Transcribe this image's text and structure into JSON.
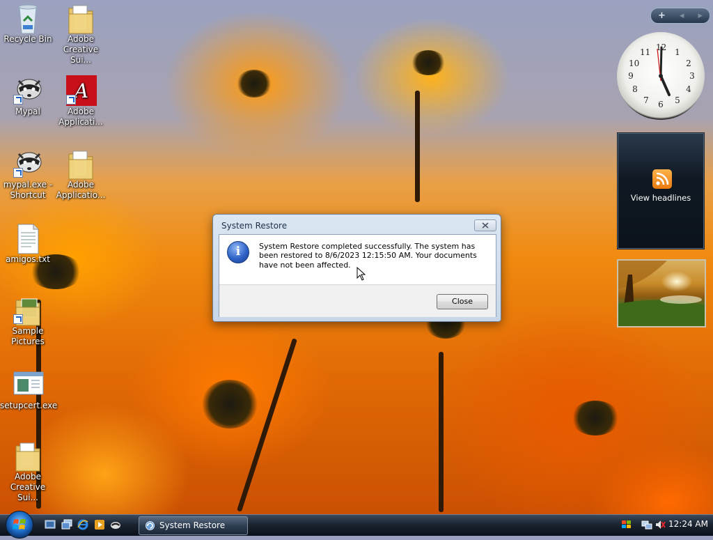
{
  "desktop": {
    "icons": [
      {
        "label": "Recycle Bin",
        "icon": "recycle-bin-icon"
      },
      {
        "label": "Adobe Creative Sui...",
        "icon": "folder-icon"
      },
      {
        "label": "Mypal",
        "icon": "raccoon-app-icon"
      },
      {
        "label": "Adobe Applicati...",
        "icon": "adobe-icon"
      },
      {
        "label": "mypal.exe - Shortcut",
        "icon": "raccoon-app-icon"
      },
      {
        "label": "Adobe Applicatio...",
        "icon": "folder-icon"
      },
      {
        "label": "amigos.txt",
        "icon": "text-file-icon"
      },
      {
        "label": "Sample Pictures",
        "icon": "folder-icon"
      },
      {
        "label": "setupcert.exe",
        "icon": "exe-window-icon"
      },
      {
        "label": "Adobe Creative Sui...",
        "icon": "folder-icon"
      }
    ]
  },
  "sidebar": {
    "controls": {
      "add": "+",
      "prev": "◂",
      "next": "▸"
    },
    "clock_time": "12:24",
    "feed_label": "View headlines"
  },
  "dialog": {
    "title": "System Restore",
    "message": "System Restore completed successfully. The system has been restored to 8/6/2023 12:15:50 AM. Your documents have not been affected.",
    "close_button": "Close"
  },
  "taskbar": {
    "task_label": "System Restore",
    "clock": "12:24 AM"
  },
  "colors": {
    "accent": "#2f63c8",
    "taskbar": "#1b2431",
    "dialog_frame": "#c7d6e8"
  }
}
